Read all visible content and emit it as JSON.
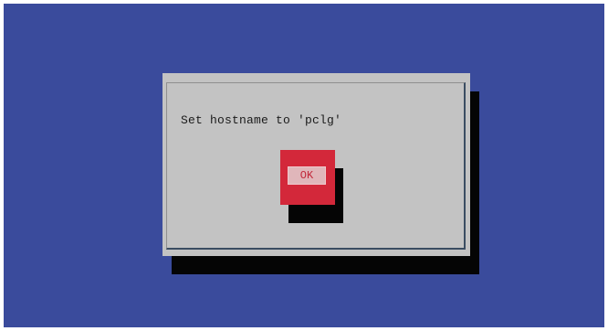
{
  "dialog": {
    "message": "Set hostname to 'pclg'",
    "ok_label": "OK"
  },
  "colors": {
    "background": "#3a4b9c",
    "dialog": "#c3c3c3",
    "button": "#d3283a",
    "shadow": "#050505"
  }
}
